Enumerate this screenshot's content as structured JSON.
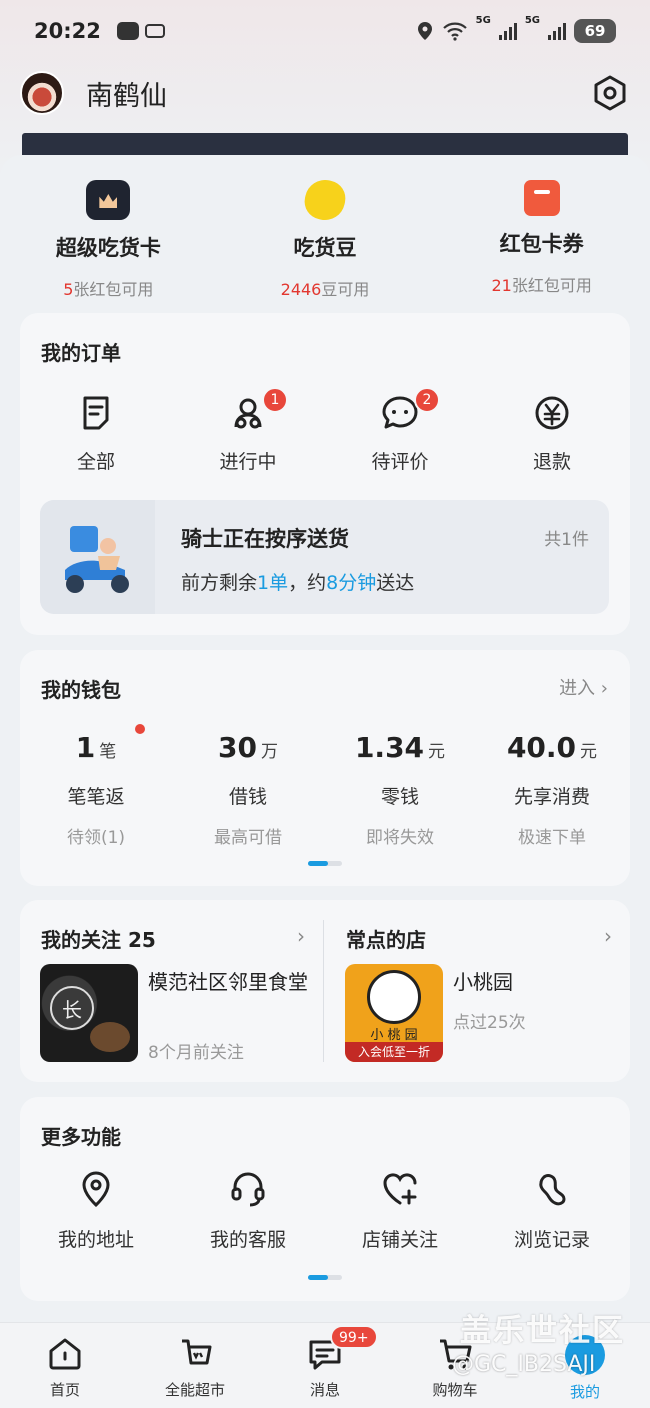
{
  "status_bar": {
    "time": "20:22",
    "network_5g_a": "5G",
    "network_5g_b": "5G",
    "battery": "69"
  },
  "profile": {
    "username": "南鹤仙"
  },
  "assets": [
    {
      "title": "超级吃货卡",
      "num": "5",
      "suffix": "张红包可用",
      "icon": "crown-card-icon"
    },
    {
      "title": "吃货豆",
      "num": "2446",
      "suffix": "豆可用",
      "icon": "bean-icon"
    },
    {
      "title": "红包卡券",
      "num": "21",
      "suffix": "张红包可用",
      "icon": "coupon-icon"
    }
  ],
  "orders": {
    "title": "我的订单",
    "items": [
      {
        "label": "全部",
        "badge": ""
      },
      {
        "label": "进行中",
        "badge": "1"
      },
      {
        "label": "待评价",
        "badge": "2"
      },
      {
        "label": "退款",
        "badge": ""
      }
    ],
    "delivery": {
      "title": "骑士正在按序送货",
      "count": "共1件",
      "eta_prefix": "前方剩余",
      "eta_orders": "1单",
      "eta_mid": "，约",
      "eta_time": "8分钟",
      "eta_suffix": "送达"
    }
  },
  "wallet": {
    "title": "我的钱包",
    "enter": "进入",
    "items": [
      {
        "value": "1",
        "unit": "笔",
        "name": "笔笔返",
        "sub": "待领(1)"
      },
      {
        "value": "30",
        "unit": "万",
        "name": "借钱",
        "sub": "最高可借"
      },
      {
        "value": "1.34",
        "unit": "元",
        "name": "零钱",
        "sub": "即将失效"
      },
      {
        "value": "40.0",
        "unit": "元",
        "name": "先享消费",
        "sub": "极速下单"
      }
    ]
  },
  "follow": {
    "title": "我的关注 25",
    "shop_name": "模范社区邻里食堂",
    "shop_sub": "8个月前关注",
    "thumb_text": "长"
  },
  "frequent": {
    "title": "常点的店",
    "shop_name": "小桃园",
    "shop_sub": "点过25次",
    "thumb_name": "小 桃 园",
    "thumb_banner": "入会低至一折"
  },
  "more": {
    "title": "更多功能",
    "items": [
      {
        "label": "我的地址"
      },
      {
        "label": "我的客服"
      },
      {
        "label": "店铺关注"
      },
      {
        "label": "浏览记录"
      }
    ]
  },
  "tabbar": {
    "items": [
      {
        "label": "首页"
      },
      {
        "label": "全能超市"
      },
      {
        "label": "消息",
        "badge": "99+"
      },
      {
        "label": "购物车"
      },
      {
        "label": "我的"
      }
    ]
  },
  "watermark": {
    "line1": "盖乐世社区",
    "line2": "@GC_IB2SAJI"
  },
  "colors": {
    "accent": "#1a9be0",
    "badge": "#e8473b",
    "price_red": "#e2372f"
  }
}
